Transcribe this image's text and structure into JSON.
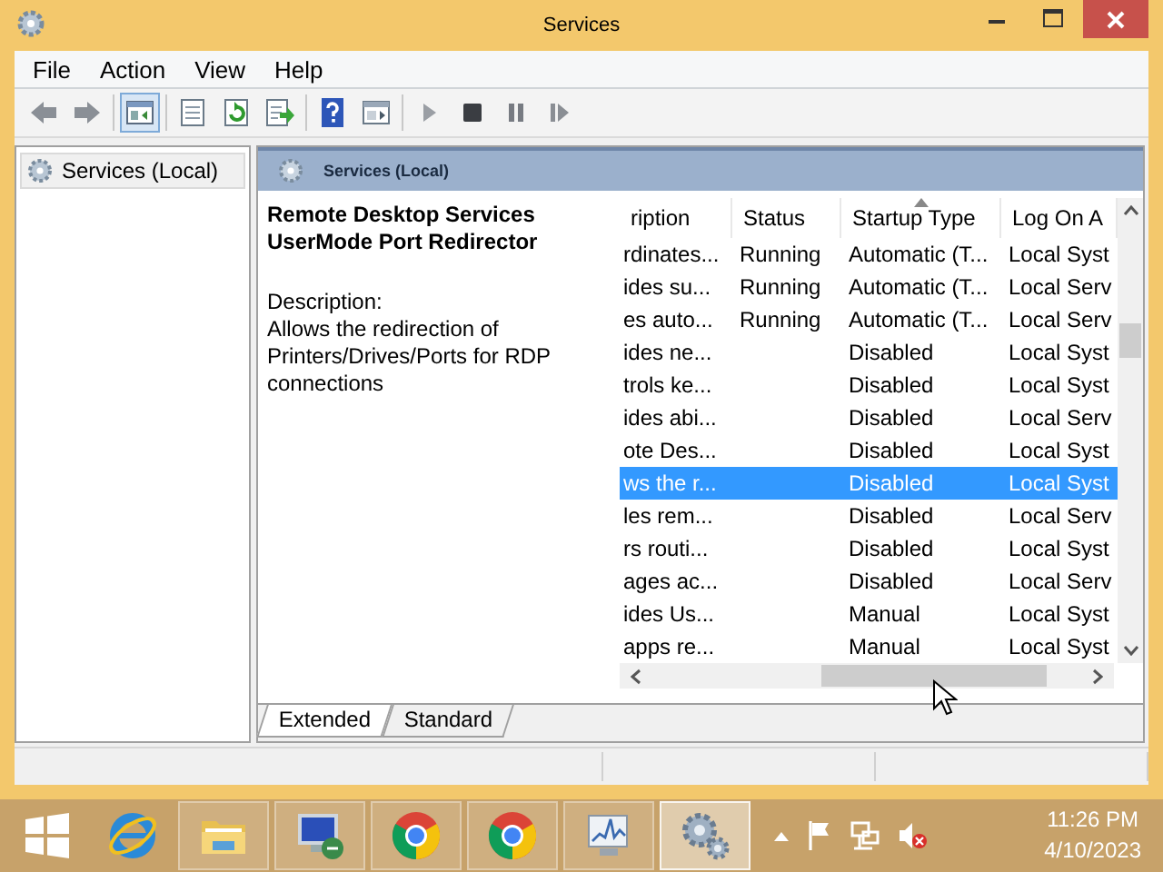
{
  "window": {
    "title": "Services"
  },
  "menu": [
    {
      "label": "File"
    },
    {
      "label": "Action"
    },
    {
      "label": "View"
    },
    {
      "label": "Help"
    }
  ],
  "toolbar": [
    [
      {
        "kind": "back",
        "pressed": false
      },
      {
        "kind": "forward",
        "pressed": false
      }
    ],
    [
      {
        "kind": "tree",
        "pressed": true
      }
    ],
    [
      {
        "kind": "document",
        "pressed": false
      },
      {
        "kind": "refresh",
        "pressed": false
      },
      {
        "kind": "export",
        "pressed": false
      }
    ],
    [
      {
        "kind": "help",
        "pressed": false
      },
      {
        "kind": "panes",
        "pressed": false
      }
    ],
    [
      {
        "kind": "start",
        "pressed": false
      },
      {
        "kind": "stop",
        "pressed": false
      },
      {
        "kind": "pause",
        "pressed": false
      },
      {
        "kind": "restart",
        "pressed": false
      }
    ]
  ],
  "tree": [
    {
      "label": "Services (Local)",
      "selected": true
    }
  ],
  "pane_header": {
    "title": "Services (Local)"
  },
  "detail": {
    "name": "Remote Desktop Services UserMode Port Redirector",
    "description_label": "Description:",
    "description": "Allows the redirection of Printers/Drives/Ports for RDP connections"
  },
  "table": {
    "columns": [
      {
        "label": "ription",
        "sorted": false
      },
      {
        "label": "Status",
        "sorted": false
      },
      {
        "label": "Startup Type",
        "sorted": true
      },
      {
        "label": "Log On A",
        "sorted": false
      }
    ],
    "rows": [
      {
        "cells": [
          "rdinates...",
          "Running",
          "Automatic (T...",
          "Local Syst"
        ],
        "selected": false
      },
      {
        "cells": [
          "ides su...",
          "Running",
          "Automatic (T...",
          "Local Serv"
        ],
        "selected": false
      },
      {
        "cells": [
          "es auto...",
          "Running",
          "Automatic (T...",
          "Local Serv"
        ],
        "selected": false
      },
      {
        "cells": [
          "ides ne...",
          "",
          "Disabled",
          "Local Syst"
        ],
        "selected": false
      },
      {
        "cells": [
          "trols ke...",
          "",
          "Disabled",
          "Local Syst"
        ],
        "selected": false
      },
      {
        "cells": [
          "ides abi...",
          "",
          "Disabled",
          "Local Serv"
        ],
        "selected": false
      },
      {
        "cells": [
          "ote Des...",
          "",
          "Disabled",
          "Local Syst"
        ],
        "selected": false
      },
      {
        "cells": [
          "ws the r...",
          "",
          "Disabled",
          "Local Syst"
        ],
        "selected": true
      },
      {
        "cells": [
          "les rem...",
          "",
          "Disabled",
          "Local Serv"
        ],
        "selected": false
      },
      {
        "cells": [
          "rs routi...",
          "",
          "Disabled",
          "Local Syst"
        ],
        "selected": false
      },
      {
        "cells": [
          "ages ac...",
          "",
          "Disabled",
          "Local Serv"
        ],
        "selected": false
      },
      {
        "cells": [
          "ides Us...",
          "",
          "Manual",
          "Local Syst"
        ],
        "selected": false
      },
      {
        "cells": [
          "apps re...",
          "",
          "Manual",
          "Local Syst"
        ],
        "selected": false
      }
    ]
  },
  "tabs": [
    {
      "label": "Extended",
      "selected": true
    },
    {
      "label": "Standard",
      "selected": false
    }
  ],
  "taskbar": {
    "apps": [
      {
        "kind": "start",
        "active": false
      },
      {
        "kind": "browser",
        "active": false
      },
      {
        "kind": "folder",
        "active": false
      },
      {
        "kind": "remote",
        "active": false
      },
      {
        "kind": "chrome",
        "active": false
      },
      {
        "kind": "chrome",
        "active": false
      },
      {
        "kind": "monitor",
        "active": false
      },
      {
        "kind": "gears",
        "active": true
      }
    ],
    "tray": [
      {
        "kind": "caret"
      },
      {
        "kind": "flag"
      },
      {
        "kind": "network"
      },
      {
        "kind": "speaker_muted"
      }
    ],
    "time": "11:26 PM",
    "date": "4/10/2023"
  }
}
